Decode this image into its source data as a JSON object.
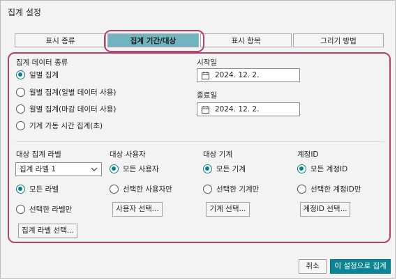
{
  "window": {
    "title": "집계 설정"
  },
  "tabs": [
    {
      "label": "표시 종류"
    },
    {
      "label": "집계 기간/대상"
    },
    {
      "label": "표시 항목"
    },
    {
      "label": "그리기 방법"
    }
  ],
  "data_type": {
    "heading": "집계 데이터 종류",
    "options": [
      {
        "label": "일별 집계",
        "selected": true
      },
      {
        "label": "월별 집계(일별 데이터 사용)",
        "selected": false
      },
      {
        "label": "월별 집계(마감 데이터 사용)",
        "selected": false
      },
      {
        "label": "기계 가동 시간 집계(초)",
        "selected": false
      }
    ]
  },
  "dates": {
    "start_label": "시작일",
    "start_value": "2024. 12. 2.",
    "end_label": "종료일",
    "end_value": "2024. 12. 2."
  },
  "targets": {
    "label_col": {
      "heading": "대상 집계 라벨",
      "select_value": "집계 라벨 1",
      "option_all": "모든 라벨",
      "option_selected": "선택한 라벨만",
      "button": "집계 라벨 선택..."
    },
    "user_col": {
      "heading": "대상 사용자",
      "option_all": "모든 사용자",
      "option_selected": "선택한 사용자만",
      "button": "사용자 선택..."
    },
    "machine_col": {
      "heading": "대상 기계",
      "option_all": "모든 기계",
      "option_selected": "선택한 기계만",
      "button": "기계 선택..."
    },
    "account_col": {
      "heading": "계정ID",
      "option_all": "모든 계정ID",
      "option_selected": "선택한 계정ID만",
      "button": "계정ID 선택..."
    }
  },
  "footer": {
    "cancel": "취소",
    "apply": "이 설정으로 집계"
  },
  "colors": {
    "accent": "#0b8493",
    "highlight": "#b2426f",
    "active_tab": "#6fb4bf"
  }
}
